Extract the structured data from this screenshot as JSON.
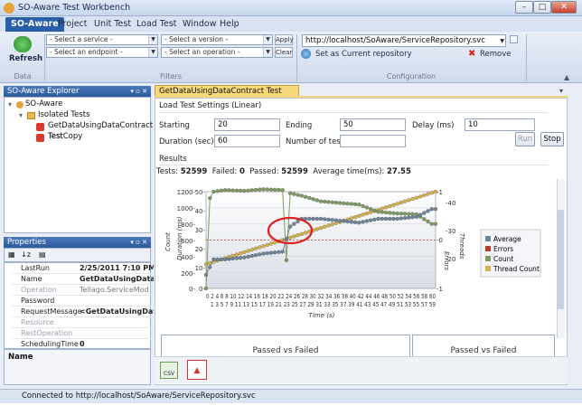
{
  "window": {
    "title": "SO-Aware Test Workbench",
    "min": "–",
    "max": "□",
    "close": "✕"
  },
  "tabs": [
    "SO-Aware",
    "Project",
    "Unit Test",
    "Load Test",
    "Window",
    "Help"
  ],
  "ribbon": {
    "refresh_label": "Refresh",
    "service_placeholder": "- Select a service -",
    "version_placeholder": "- Select a version -",
    "endpoint_placeholder": "- Select an endpoint -",
    "operation_placeholder": "- Select an operation -",
    "apply_label": "Apply",
    "clear_label": "Clear",
    "repo_url": "http://localhost/SoAware/ServiceRepository.svc",
    "set_current_label": "Set as Current repository",
    "remove_label": "Remove",
    "groups": {
      "data": "Data",
      "filters": "Filters",
      "configuration": "Configuration"
    }
  },
  "explorer": {
    "title": "SO-Aware Explorer",
    "root": "SO-Aware",
    "folder": "Isolated Tests",
    "items": [
      "GetDataUsingDataContract Test",
      "TestCopy"
    ]
  },
  "properties": {
    "title": "Properties",
    "rows": [
      {
        "key": "LastRun",
        "value": "2/25/2011 7:10 PM"
      },
      {
        "key": "Name",
        "value": "GetDataUsingDataC"
      },
      {
        "key": "Operation",
        "value": "Tellago.ServiceMod"
      },
      {
        "key": "Password",
        "value": ""
      },
      {
        "key": "RequestMessage",
        "value": "<GetDataUsingData"
      },
      {
        "key": "Resource",
        "value": ""
      },
      {
        "key": "RestOperation",
        "value": ""
      },
      {
        "key": "SchedulingTime",
        "value": "0"
      }
    ],
    "description_title": "Name"
  },
  "document": {
    "tab": "GetDataUsingDataContract Test Load Test",
    "settings_title": "Load Test Settings (Linear)",
    "starting_label": "Starting",
    "starting_value": "20",
    "ending_label": "Ending",
    "ending_value": "50",
    "delay_label": "Delay (ms)",
    "delay_value": "10",
    "duration_label": "Duration (sec)",
    "duration_value": "60",
    "numtests_label": "Number of tests",
    "numtests_value": "",
    "run_label": "Run",
    "stop_label": "Stop",
    "results_title": "Results",
    "tests_label": "Tests:",
    "tests_value": "52599",
    "failed_label": "Failed:",
    "failed_value": "0",
    "passed_label": "Passed:",
    "passed_value": "52599",
    "avg_label": "Average time(ms):",
    "avg_value": "27.55",
    "passfail_left": "Passed vs Failed",
    "passfail_right": "Passed vs Failed"
  },
  "status": {
    "text": "Connected to http://localhost/SoAware/ServiceRepository.svc"
  },
  "chart_data": {
    "type": "line",
    "xlabel": "Time (s)",
    "ylabel_count": "Count",
    "ylabel_duration": "Duration (ms)",
    "ylabel_errors": "Errors",
    "ylabel_threads": "Threads",
    "x_ticks_row1": "0 2 4 6 8 10 12 14 16 18 20 22 24 26 28 30 32 34 36 38 40 42 44 46 48 50 52 54 56 58 60",
    "x_ticks_row2": "1 3 5 7 9 11 13 15 17 19 21 23 25 27 29 31 33 35 37 39 41 43 45 47 49 51 53 55 57 59",
    "count_ticks": [
      "1200-",
      "1000-",
      "800-",
      "600-",
      "400-",
      "200-",
      "0-"
    ],
    "duration_ticks": [
      "50-",
      "40-",
      "30-",
      "20-",
      "10-",
      "0-"
    ],
    "errors_ticks": [
      "-1",
      "-0",
      "-1"
    ],
    "threads_ticks": [
      "-40",
      "-30",
      "-20"
    ],
    "legend": [
      "Average",
      "Errors",
      "Count",
      "Thread Count"
    ],
    "colors": {
      "average": "#6f8399",
      "errors": "#c0392b",
      "count": "#7e9c62",
      "threads": "#d8b24a",
      "highlight": "#e02020"
    },
    "xlim": [
      0,
      60
    ],
    "thread_count": {
      "x": [
        0,
        60
      ],
      "y": [
        20,
        50
      ]
    },
    "average": {
      "x": [
        0,
        2,
        5,
        10,
        15,
        20,
        22,
        25,
        30,
        35,
        40,
        45,
        50,
        55,
        59
      ],
      "y": [
        7,
        15,
        15,
        16,
        18,
        19,
        32,
        36,
        36,
        35,
        34,
        36,
        36,
        37,
        41
      ]
    },
    "count": {
      "x": [
        0,
        1,
        2,
        5,
        10,
        15,
        20,
        21,
        22,
        25,
        30,
        35,
        40,
        45,
        50,
        55,
        59
      ],
      "y": [
        0,
        1120,
        1200,
        1220,
        1210,
        1230,
        1220,
        350,
        1180,
        1150,
        1080,
        1060,
        1040,
        950,
        930,
        920,
        800
      ]
    },
    "errors": {
      "x": [
        0,
        60
      ],
      "y": [
        0,
        0
      ]
    }
  }
}
